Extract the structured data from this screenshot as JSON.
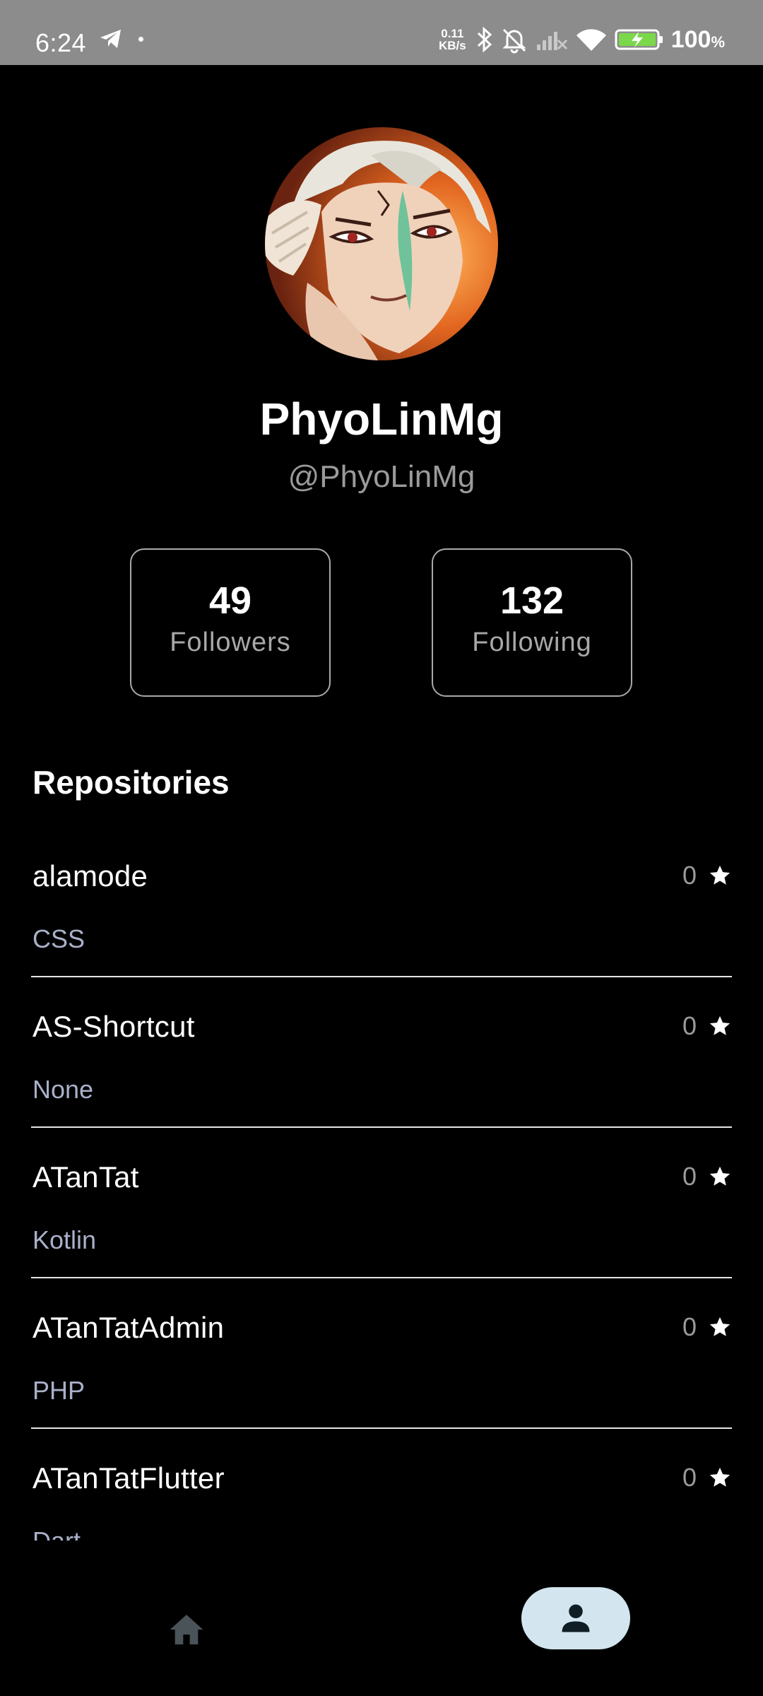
{
  "status_bar": {
    "time": "6:24",
    "net_speed_value": "0.11",
    "net_speed_unit": "KB/s",
    "battery_level": "100",
    "battery_unit": "%"
  },
  "profile": {
    "name": "PhyoLinMg",
    "handle": "@PhyoLinMg",
    "followers_count": "49",
    "followers_label": "Followers",
    "following_count": "132",
    "following_label": "Following"
  },
  "repositories": {
    "title": "Repositories",
    "items": [
      {
        "name": "alamode",
        "language": "CSS",
        "stars": "0"
      },
      {
        "name": "AS-Shortcut",
        "language": "None",
        "stars": "0"
      },
      {
        "name": "ATanTat",
        "language": "Kotlin",
        "stars": "0"
      },
      {
        "name": "ATanTatAdmin",
        "language": "PHP",
        "stars": "0"
      },
      {
        "name": "ATanTatFlutter",
        "language": "Dart",
        "stars": "0"
      }
    ]
  },
  "bottom_nav": {
    "items": [
      {
        "icon": "home-icon",
        "active": false
      },
      {
        "icon": "person-icon",
        "active": true
      }
    ]
  },
  "colors": {
    "background": "#000000",
    "status_bar": "#8c8c8c",
    "secondary_text": "#9b9b9b",
    "language_text": "#a9b1c9",
    "active_nav_pill": "#d3e6ef",
    "home_icon": "#4a5358"
  }
}
